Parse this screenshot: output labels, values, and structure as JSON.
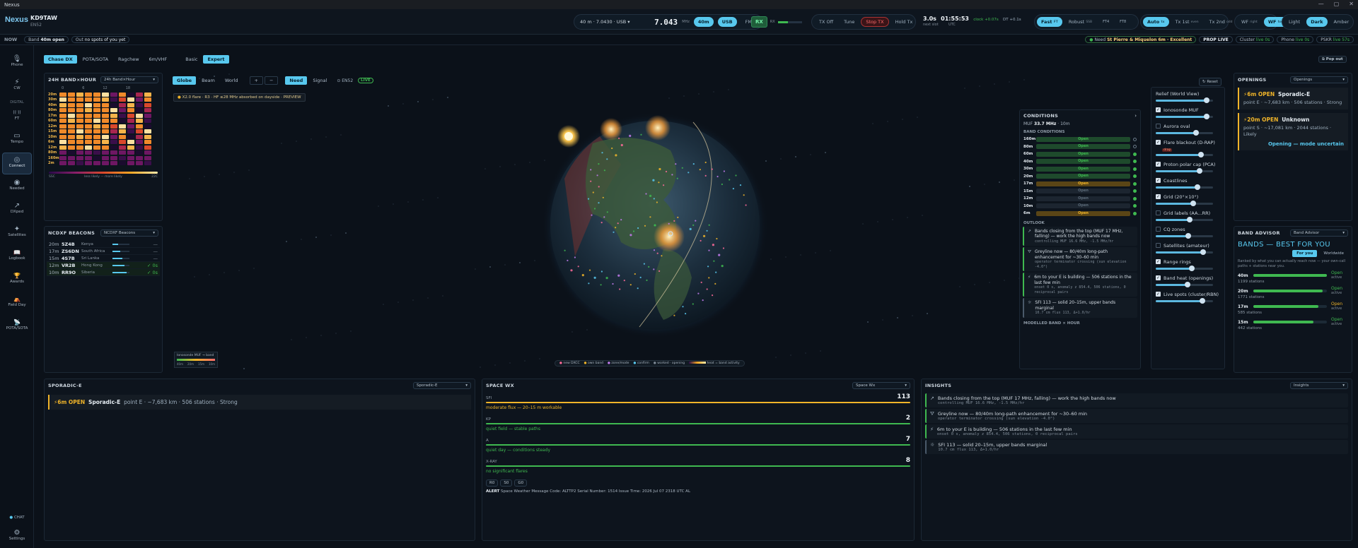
{
  "window": {
    "title": "Nexus",
    "controls": [
      "—",
      "▢",
      "✕"
    ]
  },
  "header": {
    "brand": "Nexus",
    "callsign": "KD9TAW",
    "grid": "EN52",
    "freq_select": "40 m · 7.0430 · USB",
    "freq_big": "7.043",
    "freq_unit": "MHz",
    "band_pill": "40m",
    "mode_usb": "USB",
    "mode_fm": "FM",
    "rx": "RX",
    "rx_meter": "RX",
    "tx_buttons": [
      "TX Off",
      "Tune",
      "Stop TX",
      "Hold Tx"
    ],
    "clock_a": "3.0s",
    "clock_a_sub": "next slot",
    "clock_b": "01:55:53",
    "clock_b_sub": "UTC",
    "clock_status": "clock +0.07s",
    "dt_status": "DT +0.1s",
    "speed_modes": [
      "Fast",
      "Robust",
      "FT4",
      "FT8"
    ],
    "speed_sub": [
      "FT",
      "SSB"
    ],
    "tx_modes": [
      "Auto",
      "Tx 1st",
      "Tx 2nd"
    ],
    "tx_subs": [
      "tx",
      "even",
      "odd"
    ],
    "wf_modes": [
      "WF",
      "WF"
    ],
    "wf_subs": [
      "right",
      "top"
    ],
    "themes": [
      "Light",
      "Dark",
      "Amber"
    ]
  },
  "nowbar": {
    "label": "NOW",
    "band_label": "Band",
    "band_value": "40m open",
    "out_label": "Out",
    "out_value": "no spots of you yet",
    "need_label": "Need",
    "need_value": "St Pierre & Miquelon 6m · Excellent",
    "prop_live": "PROP LIVE",
    "cluster": "Cluster",
    "cluster_val": "live 0s",
    "phone": "Phone",
    "phone_val": "live 0s",
    "pskr": "PSKR",
    "pskr_val": "live 57s"
  },
  "sidebar": {
    "items": [
      {
        "icon": "🎙",
        "label": "Phone"
      },
      {
        "icon": "⚡",
        "label": "CW"
      },
      {
        "section": "DIGITAL"
      },
      {
        "icon": "((·))",
        "label": "FT"
      },
      {
        "icon": "▭",
        "label": "Tempo"
      },
      {
        "icon": "◎",
        "label": "Connect"
      },
      {
        "icon": "◉",
        "label": "Needed"
      },
      {
        "icon": "↗",
        "label": "DXped"
      },
      {
        "icon": "✦",
        "label": "Satellites"
      },
      {
        "icon": "📖",
        "label": "Logbook"
      },
      {
        "icon": "🏆",
        "label": "Awards"
      },
      {
        "icon": "⛺",
        "label": "Field Day"
      },
      {
        "icon": "📡",
        "label": "POTA/SOTA"
      }
    ],
    "chat": "CHAT",
    "settings": "Settings"
  },
  "tabs": {
    "main": [
      "Chase DX",
      "POTA/SOTA",
      "Ragchew",
      "6m/VHF"
    ],
    "level": [
      "Basic",
      "Expert"
    ],
    "popout": "Pop out"
  },
  "band_hour": {
    "title": "24H BAND×HOUR",
    "select": "24h Band×Hour",
    "hours": [
      "0",
      "6",
      "12",
      "18"
    ],
    "bands": [
      "20m",
      "30m",
      "40m",
      "80m",
      "17m",
      "60m",
      "12m",
      "15m",
      "10m",
      "6m",
      "12m",
      "80m",
      "160m",
      "2m"
    ],
    "legend_left": "SSC",
    "legend_mid": "less likely ··· more likely",
    "legend_right": "22C"
  },
  "beacons": {
    "title": "NCDXF BEACONS",
    "select": "NCDXF Beacons",
    "rows": [
      {
        "band": "20m",
        "call": "5Z4B",
        "loc": "Kenya",
        "st": "—"
      },
      {
        "band": "17m",
        "call": "ZS6DN",
        "loc": "South Africa",
        "st": "—"
      },
      {
        "band": "15m",
        "call": "4S7B",
        "loc": "Sri Lanka",
        "st": "—"
      },
      {
        "band": "12m",
        "call": "VR2B",
        "loc": "Hong Kong",
        "st": "✓ 0s"
      },
      {
        "band": "10m",
        "call": "RR9O",
        "loc": "Siberia",
        "st": "✓ 0s"
      }
    ]
  },
  "globe": {
    "views": [
      "Globe",
      "Beam",
      "World"
    ],
    "zoom": [
      "+",
      "−"
    ],
    "filters": [
      "Need",
      "Signal"
    ],
    "grid": "EN52",
    "live": "LIVE",
    "alert": "X2.0 flare · R3 · HF ≤28 MHz absorbed on dayside · PREVIEW",
    "reset": "Reset",
    "muf_legend": "Ionosonde MUF → band",
    "muf_ticks": [
      "40m",
      "20m",
      "15m",
      "10m"
    ],
    "legend": [
      "new DXCC",
      "own band",
      "zone/mode",
      "confirm",
      "worked · opening",
      "heat = band activity"
    ]
  },
  "conditions": {
    "title": "CONDITIONS",
    "muf_label": "MUF",
    "muf": "33.7 MHz",
    "muf_age": "10m",
    "band_title": "BAND CONDITIONS",
    "bands": [
      {
        "b": "160m",
        "s": "Open"
      },
      {
        "b": "80m",
        "s": "Open"
      },
      {
        "b": "60m",
        "s": "Open"
      },
      {
        "b": "40m",
        "s": "Open"
      },
      {
        "b": "30m",
        "s": "Open"
      },
      {
        "b": "20m",
        "s": "Open"
      },
      {
        "b": "17m",
        "s": "Open"
      },
      {
        "b": "15m",
        "s": "Open"
      },
      {
        "b": "12m",
        "s": "Open"
      },
      {
        "b": "10m",
        "s": "Open"
      },
      {
        "b": "6m",
        "s": "Open"
      }
    ],
    "outlook_title": "OUTLOOK",
    "outlook": [
      {
        "t": "Bands closing from the top (MUF 17 MHz, falling) — work the high bands now",
        "s": "controlling MUF 16.6 MHz, -1.5 MHz/hr"
      },
      {
        "t": "Greyline now — 80/40m long-path enhancement for ~30–60 min",
        "s": "operator terminator crossing (sun elevation -4.0°)"
      },
      {
        "t": "6m to your E is building — 506 stations in the last few min",
        "s": "onset 0 s, anomaly z 854.4, 506 stations, 0 reciprocal pairs"
      },
      {
        "t": "SFI 113 — solid 20–15m, upper bands marginal",
        "s": "10.7 cm flux 113, Δ+1.0/hr"
      }
    ],
    "model_title": "MODELLED BAND × HOUR",
    "model_ticks": [
      "0",
      "6",
      "12",
      "18"
    ]
  },
  "layers": {
    "partial": "Relief (World View)",
    "items": [
      {
        "label": "Ionosonde MUF",
        "on": true
      },
      {
        "label": "Aurora oval",
        "on": false
      },
      {
        "label": "Flare blackout (D-RAP)",
        "on": true,
        "badge": "drap"
      },
      {
        "label": "Proton polar cap (PCA)",
        "on": true
      },
      {
        "label": "Coastlines",
        "on": true
      },
      {
        "label": "Grid (20°×10°)",
        "on": true
      },
      {
        "label": "Grid labels (AA...RR)",
        "on": false
      },
      {
        "label": "CQ zones",
        "on": false
      },
      {
        "label": "Satellites (amateur)",
        "on": false
      },
      {
        "label": "Range rings",
        "on": true
      },
      {
        "label": "Band heat (openings)",
        "on": true
      },
      {
        "label": "Live spots (cluster/RBN)",
        "on": true
      }
    ]
  },
  "openings": {
    "title": "OPENINGS",
    "select": "Openings",
    "cards": [
      {
        "head": "6m OPEN",
        "mode": "Sporadic-E",
        "detail": "point E · ~7,683 km · 506 stations · Strong"
      },
      {
        "head": "20m OPEN",
        "mode": "Unknown",
        "detail": "point S · ~17,081 km · 2044 stations · Likely"
      }
    ],
    "uncertain": "Opening — mode uncertain"
  },
  "advisor": {
    "title": "BAND ADVISOR",
    "select": "Band Advisor",
    "heading": "BANDS — BEST FOR YOU",
    "tabs": [
      "For you",
      "Worldwide"
    ],
    "desc": "Ranked by what you can actually reach now — your own-call paths + stations near you.",
    "rows": [
      {
        "b": "40m",
        "n": "1199 stations",
        "s": "Open",
        "sub": "active"
      },
      {
        "b": "20m",
        "n": "1771 stations",
        "s": "Open",
        "sub": "active"
      },
      {
        "b": "17m",
        "n": "585 stations",
        "s": "Open",
        "sub": "active"
      },
      {
        "b": "15m",
        "n": "442 stations",
        "s": "Open",
        "sub": "active"
      }
    ]
  },
  "sporadic": {
    "title": "SPORADIC-E",
    "select": "Sporadic-E",
    "head": "6m OPEN",
    "mode": "Sporadic-E",
    "detail": "point E · ~7,683 km · 506 stations · Strong"
  },
  "spacewx": {
    "title": "SPACE WX",
    "select": "Space Wx",
    "rows": [
      {
        "k": "SFI",
        "v": "113",
        "d": "moderate flux — 20–15 m workable",
        "c": "#f0b429"
      },
      {
        "k": "KP",
        "v": "2",
        "d": "quiet field — stable paths",
        "c": "#3fb950"
      },
      {
        "k": "A",
        "v": "7",
        "d": "quiet day — conditions steady",
        "c": "#3fb950"
      },
      {
        "k": "X-RAY",
        "v": "8",
        "d": "no significant flares",
        "c": "#3fb950"
      }
    ],
    "chips": [
      "R0",
      "S0",
      "G0"
    ],
    "alert_label": "ALERT",
    "alert": "Space Weather Message Code: ALTTP2 Serial Number: 1514 Issue Time: 2026 Jul 07 2318 UTC AL"
  },
  "insights": {
    "title": "INSIGHTS",
    "select": "Insights"
  },
  "colors": {
    "accent": "#58c8ee",
    "open": "#3fb950",
    "warn": "#f0b429",
    "danger": "#ff6b6b"
  }
}
